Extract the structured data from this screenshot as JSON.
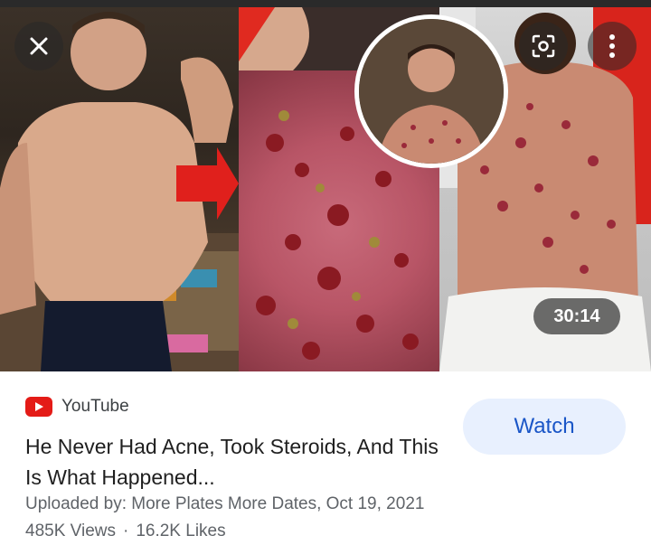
{
  "source": {
    "name": "YouTube",
    "logo_color": "#e41b17"
  },
  "video": {
    "duration": "30:14",
    "title": "He Never Had Acne, Took Steroids, And This Is What Happened...",
    "uploaded": "Uploaded by: More Plates More Dates, Oct 19, 2021",
    "views": "485K Views",
    "separator": "·",
    "likes": "16.2K Likes"
  },
  "actions": {
    "watch_label": "Watch"
  },
  "icons": {
    "close": "close-icon",
    "lens": "lens-search-icon",
    "more": "more-vert-icon"
  },
  "colors": {
    "accent": "#1a56c7",
    "button_bg": "#e8f0fe",
    "meta": "#5f6368"
  }
}
